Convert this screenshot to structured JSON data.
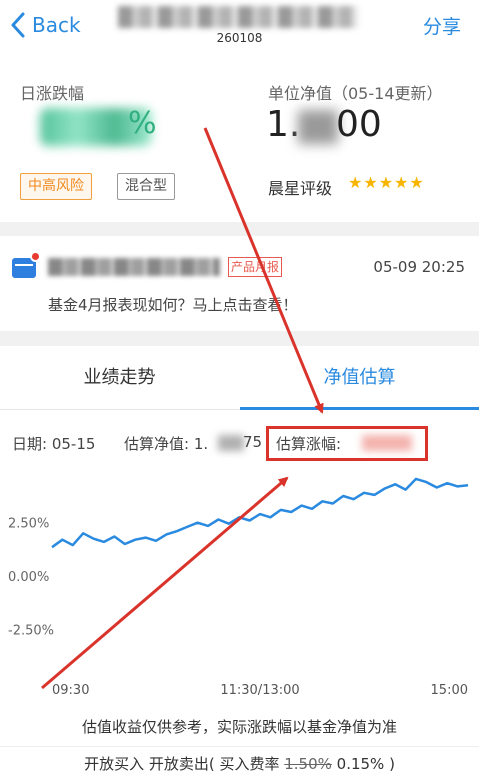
{
  "nav": {
    "back_label": "Back",
    "fund_code": "260108",
    "share_label": "分享"
  },
  "info": {
    "daily_change_label": "日涨跌幅",
    "daily_change_suffix": "%",
    "unit_nav_label": "单位净值（05-14更新）",
    "unit_nav_prefix": "1.",
    "unit_nav_suffix": "00",
    "risk_tag": "中高风险",
    "type_tag": "混合型",
    "rating_label": "晨星评级",
    "rating_stars": 5,
    "stars_text": "★★★★★"
  },
  "news": {
    "tag": "产品月报",
    "time": "05-09 20:25",
    "text": "基金4月报表现如何？马上点击查看！"
  },
  "tabs": {
    "performance": "业绩走势",
    "estimate": "净值估算"
  },
  "estimate": {
    "date_label": "日期: 05-15",
    "net_label": "估算净值: 1.",
    "net_suffix": "75",
    "change_label": "估算涨幅: "
  },
  "chart_data": {
    "type": "line",
    "xlabel": "",
    "ylabel": "",
    "ytick_labels": [
      "2.50%",
      "0.00%",
      "-2.50%"
    ],
    "xtick_labels": [
      "09:30",
      "11:30/13:00",
      "15:00"
    ],
    "ylim": [
      -4.5,
      4.5
    ],
    "x": [
      0,
      6,
      12,
      18,
      24,
      30,
      36,
      42,
      48,
      54,
      60,
      66,
      72,
      78,
      84,
      90,
      96,
      102,
      108,
      114,
      120,
      126,
      132,
      138,
      144,
      150,
      156,
      162,
      168,
      174,
      180,
      186,
      192,
      198,
      204,
      210,
      216,
      222,
      228,
      234,
      240
    ],
    "series": [
      {
        "values": [
          1.35,
          1.7,
          1.45,
          2.0,
          1.75,
          1.6,
          1.85,
          1.5,
          1.7,
          1.8,
          1.65,
          1.95,
          2.1,
          2.3,
          2.5,
          2.35,
          2.65,
          2.45,
          2.75,
          2.6,
          2.9,
          2.75,
          3.1,
          3.0,
          3.3,
          3.15,
          3.5,
          3.4,
          3.75,
          3.6,
          3.9,
          3.8,
          4.1,
          4.3,
          4.05,
          4.55,
          4.4,
          4.15,
          4.35,
          4.2,
          4.25
        ]
      }
    ],
    "color": "#2a8ae0",
    "grid": false
  },
  "footer": {
    "disclaimer": "估值收益仅供参考，实际涨跌幅以基金净值为准",
    "trade_prefix": "开放买入 开放卖出( 买入费率 ",
    "fee_original": "1.50%",
    "fee_actual": " 0.15% )"
  },
  "colors": {
    "accent": "#2a8ae0",
    "annotation_red": "#d9332b",
    "star": "#f7b500",
    "risk": "#f08a1e"
  }
}
